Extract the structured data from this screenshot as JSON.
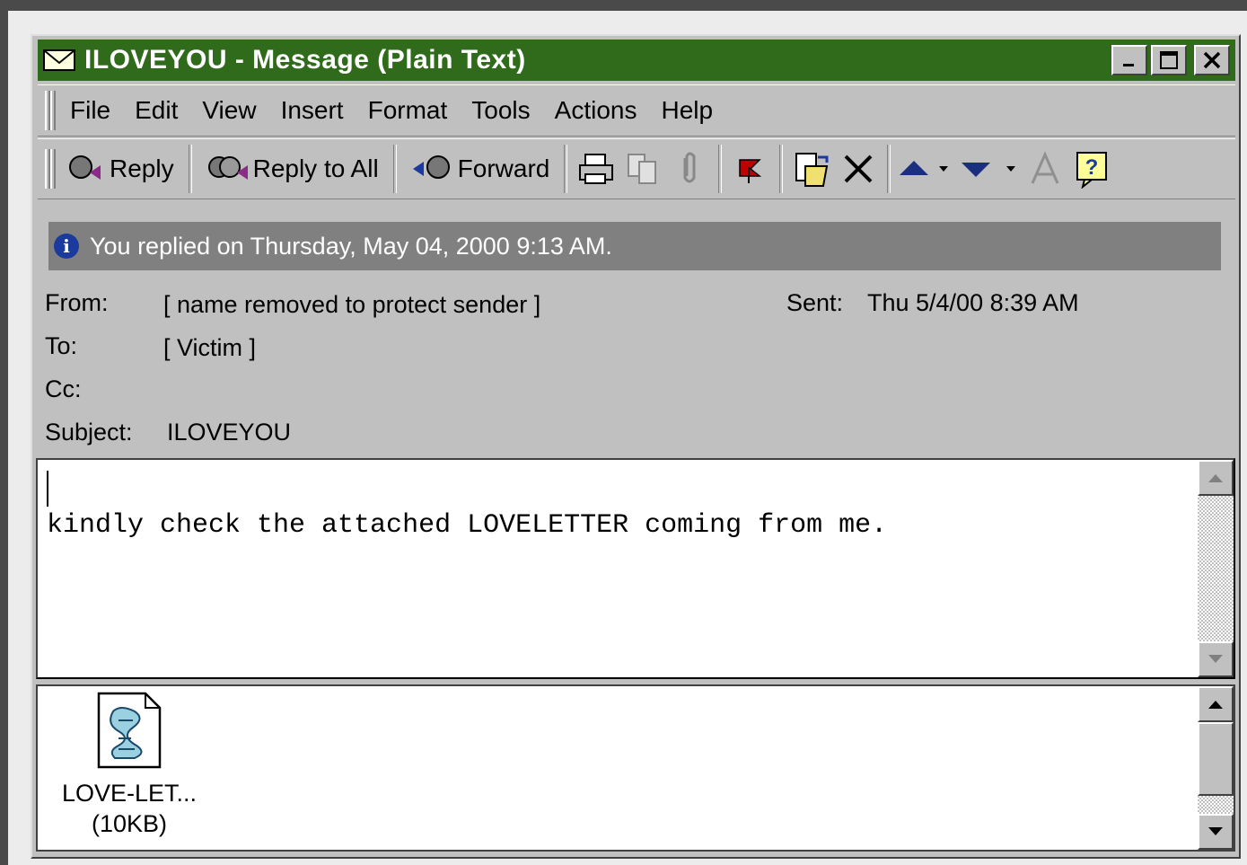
{
  "window": {
    "title": "ILOVEYOU - Message (Plain Text)"
  },
  "menu": [
    "File",
    "Edit",
    "View",
    "Insert",
    "Format",
    "Tools",
    "Actions",
    "Help"
  ],
  "toolbar": {
    "reply": "Reply",
    "reply_all": "Reply to All",
    "forward": "Forward"
  },
  "infobar": {
    "text": "You replied on Thursday, May 04, 2000 9:13 AM."
  },
  "header": {
    "from_label": "From:",
    "from_value": "[ name removed to protect sender ]",
    "sent_label": "Sent:",
    "sent_value": "Thu 5/4/00 8:39 AM",
    "to_label": "To:",
    "to_value": "[ Victim ]",
    "cc_label": "Cc:",
    "cc_value": "",
    "subject_label": "Subject:",
    "subject_value": "ILOVEYOU"
  },
  "body": {
    "text": "kindly check the attached LOVELETTER coming from me."
  },
  "attachment": {
    "name": "LOVE-LET...",
    "size": "(10KB)",
    "icon": "script-file-icon"
  },
  "colors": {
    "titlebar": "#2f6b1b",
    "infobar": "#808080",
    "chrome": "#c0c0c0"
  }
}
